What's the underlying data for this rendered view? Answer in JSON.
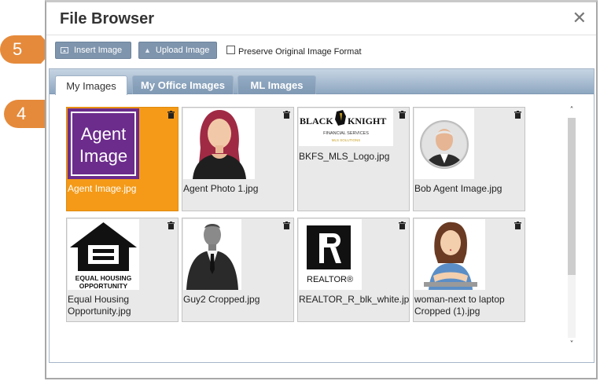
{
  "dialog": {
    "title": "File Browser",
    "close_symbol": "✕"
  },
  "toolbar": {
    "insert_label": "Insert Image",
    "upload_label": "Upload Image",
    "preserve_label": "Preserve Original Image Format",
    "preserve_checked": false
  },
  "tabs": [
    {
      "label": "My Images",
      "active": true
    },
    {
      "label": "My Office Images",
      "active": false
    },
    {
      "label": "ML Images",
      "active": false
    }
  ],
  "images": [
    {
      "name": "Agent Image.jpg",
      "selected": true,
      "thumb_icon": "agent-image-logo",
      "logo_lines": [
        "Agent",
        "Image"
      ]
    },
    {
      "name": "Agent Photo 1.jpg",
      "selected": false,
      "thumb_icon": "woman-avatar"
    },
    {
      "name": "BKFS_MLS_Logo.jpg",
      "selected": false,
      "thumb_icon": "black-knight-logo",
      "logo_lines": [
        "BLACK",
        "KNIGHT",
        "FINANCIAL SERVICES",
        "MLS SOLUTIONS"
      ]
    },
    {
      "name": "Bob Agent Image.jpg",
      "selected": false,
      "thumb_icon": "man-portrait"
    },
    {
      "name": "Equal Housing Opportunity.jpg",
      "selected": false,
      "thumb_icon": "equal-housing-logo",
      "logo_lines": [
        "EQUAL HOUSING",
        "OPPORTUNITY"
      ]
    },
    {
      "name": "Guy2 Cropped.jpg",
      "selected": false,
      "thumb_icon": "man-suit-avatar"
    },
    {
      "name": "REALTOR_R_blk_white.jpg",
      "selected": false,
      "thumb_icon": "realtor-logo",
      "logo_lines": [
        "REALTOR®"
      ]
    },
    {
      "name": "woman-next to laptop Cropped (1).jpg",
      "selected": false,
      "thumb_icon": "woman-laptop-avatar"
    }
  ],
  "callouts": [
    "5",
    "4"
  ],
  "colors": {
    "selected_card": "#f49a18",
    "callout": "#e58a3b",
    "button": "#7f95ad",
    "agent_logo_bg": "#6c2c8c"
  },
  "scrollbar": {
    "up": "˄",
    "down": "˅"
  }
}
